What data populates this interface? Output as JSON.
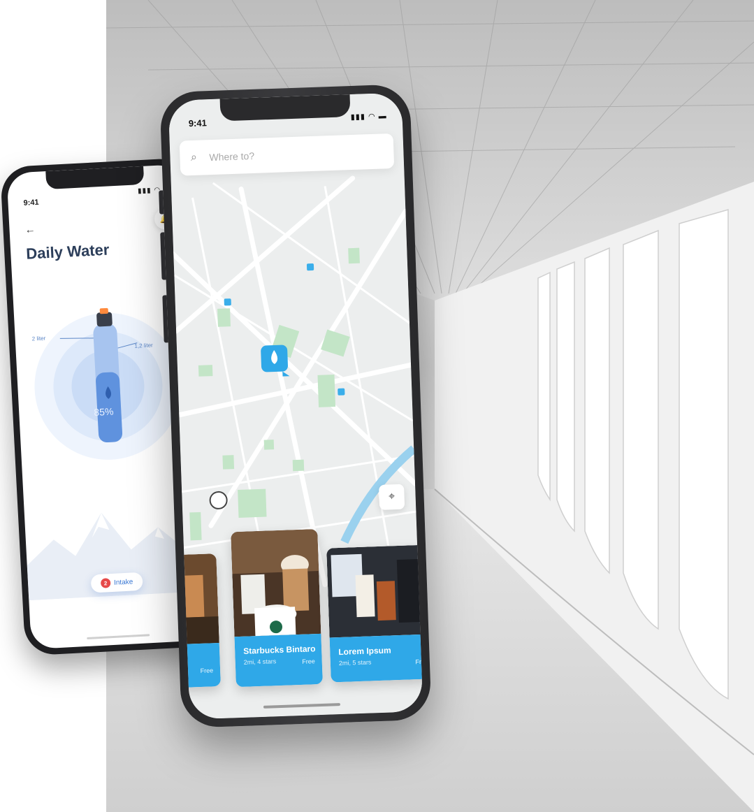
{
  "daily_water": {
    "time": "9:41",
    "status": "▮▮▮ ◠ ▬",
    "back": "←",
    "bell": "🔔",
    "title": "Daily Water",
    "label_left": "2 liter",
    "label_right": "1,2 liter",
    "percent": "85%",
    "intake_badge": "2",
    "intake_label": "Intake",
    "accent": "#4a7fd4"
  },
  "map_app": {
    "time": "9:41",
    "status": "▮▮▮ ◠ ▬",
    "search_placeholder": "Where to?",
    "locate_icon": "⌖",
    "cards": [
      {
        "name": "",
        "sub": "",
        "price": "Free"
      },
      {
        "name": "Starbucks Bintaro",
        "sub": "2mi, 4 stars",
        "price": "Free"
      },
      {
        "name": "Lorem Ipsum",
        "sub": "2mi, 5 stars",
        "price": "Fr"
      }
    ],
    "accent": "#2fa8e8",
    "park_color": "#bfe3c4",
    "water_color": "#9ad1ee"
  }
}
